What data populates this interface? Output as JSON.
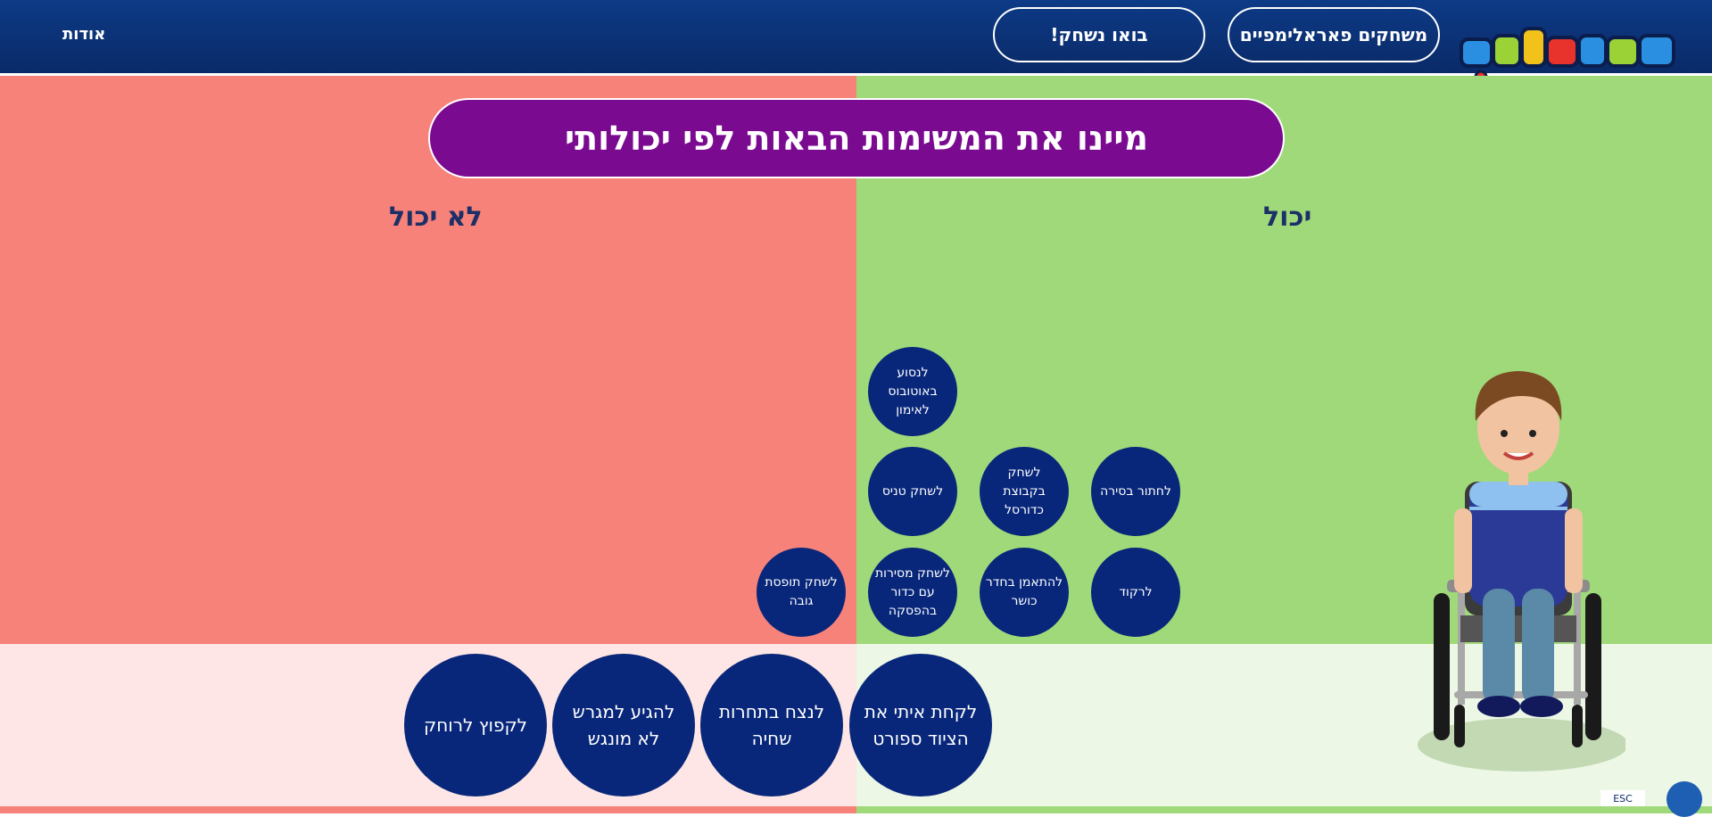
{
  "header": {
    "nav_games": "משחקים פאראלימפיים",
    "nav_play": "בואו נשחק!",
    "nav_about": "אודות"
  },
  "main": {
    "instruction": "מיינו את המשימות הבאות לפי יכולותי",
    "can_title": "יכול",
    "cannot_title": "לא יכול"
  },
  "tasks_small": [
    "לנסוע באוטובוס לאימון",
    "לשחק טניס",
    "לשחק בקבוצת כדורסל",
    "לחתור בסירה",
    "לשחק תופסת גובה",
    "לשחק מסירות עם כדור בהפסקה",
    "להתאמן בחדר כושר",
    "לרקוד"
  ],
  "tasks_large": [
    "לקחת איתי את הציוד ספורט",
    "לנצח בתחרות שחיה",
    "להגיע למגרש לא מונגש",
    "לקפוץ לרוחק"
  ],
  "esc": "ESC",
  "icons": {
    "logo": "paralimpi-logo",
    "character": "wheelchair-boy",
    "accessibility": "accessibility-icon"
  }
}
